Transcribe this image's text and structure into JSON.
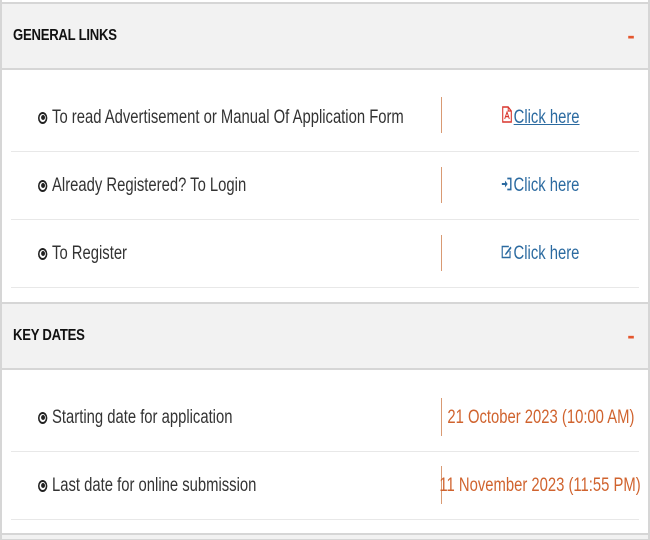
{
  "general_links": {
    "title": "GENERAL LINKS",
    "toggle": "-",
    "rows": [
      {
        "label": "To read Advertisement or Manual Of Application Form",
        "link_text": "Click here",
        "icon": "pdf-icon"
      },
      {
        "label": "Already Registered? To Login",
        "link_text": "Click here",
        "icon": "sign-in-icon"
      },
      {
        "label": "To Register",
        "link_text": "Click here",
        "icon": "edit-icon"
      }
    ]
  },
  "key_dates": {
    "title": "KEY DATES",
    "toggle": "-",
    "rows": [
      {
        "label": "Starting date for application",
        "value": "21 October 2023 (10:00 AM)"
      },
      {
        "label": "Last date for online submission",
        "value": "11 November 2023 (11:55 PM)"
      }
    ]
  },
  "colors": {
    "accent": "#e4572e",
    "link": "#2b6aa0",
    "date": "#d0632e",
    "header_bg": "#f2f2f2"
  }
}
